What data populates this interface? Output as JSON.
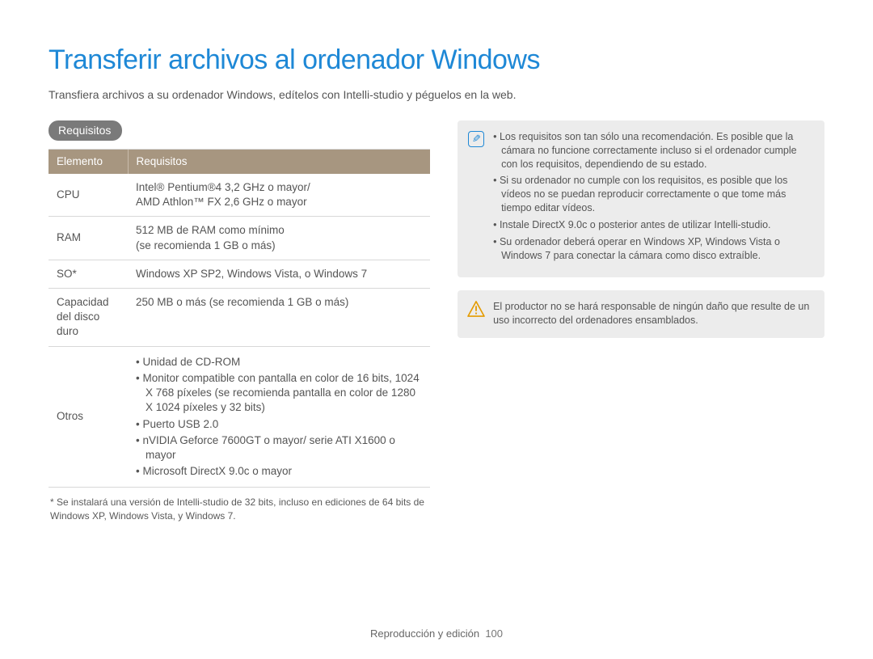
{
  "title": "Transferir archivos al ordenador Windows",
  "intro": "Transfiera archivos a su ordenador Windows, edítelos con Intelli-studio y péguelos en la web.",
  "section_badge": "Requisitos",
  "table": {
    "headers": {
      "element": "Elemento",
      "requirements": "Requisitos"
    },
    "rows": {
      "cpu": {
        "label": "CPU",
        "line1": "Intel® Pentium®4 3,2 GHz o mayor/",
        "line2": "AMD Athlon™ FX 2,6 GHz o mayor"
      },
      "ram": {
        "label": "RAM",
        "line1": "512 MB de RAM como mínimo",
        "line2": "(se recomienda 1 GB o más)"
      },
      "so": {
        "label": "SO*",
        "value": "Windows XP SP2, Windows Vista, o Windows 7"
      },
      "disk": {
        "label": "Capacidad del disco duro",
        "value": "250 MB o más (se recomienda 1 GB o más)"
      },
      "others": {
        "label": "Otros",
        "li1": "Unidad de CD-ROM",
        "li2": "Monitor compatible con pantalla en color de 16 bits, 1024 X 768 píxeles (se recomienda pantalla en color de 1280 X 1024 píxeles y 32 bits)",
        "li3": "Puerto USB 2.0",
        "li4": "nVIDIA Geforce 7600GT o mayor/ serie ATI X1600 o mayor",
        "li5": "Microsoft DirectX 9.0c o mayor"
      }
    }
  },
  "footnote": "* Se instalará una versión de Intelli-studio de 32 bits, incluso en ediciones de 64 bits de Windows XP, Windows Vista, y Windows 7.",
  "info_box": {
    "li1": "Los requisitos son tan sólo una recomendación. Es posible que la cámara no funcione correctamente incluso si el ordenador cumple con los requisitos, dependiendo de su estado.",
    "li2": "Si su ordenador no cumple con los requisitos, es posible que los vídeos no se puedan reproducir correctamente o que tome más tiempo editar vídeos.",
    "li3": "Instale DirectX 9.0c o posterior antes de utilizar Intelli-studio.",
    "li4": "Su ordenador deberá operar en Windows XP, Windows Vista o Windows 7 para conectar la cámara como disco extraíble."
  },
  "warn_box": {
    "text": "El productor no se hará responsable de ningún daño que resulte de un uso incorrecto del ordenadores ensamblados."
  },
  "footer": {
    "section": "Reproducción y edición",
    "page": "100"
  }
}
